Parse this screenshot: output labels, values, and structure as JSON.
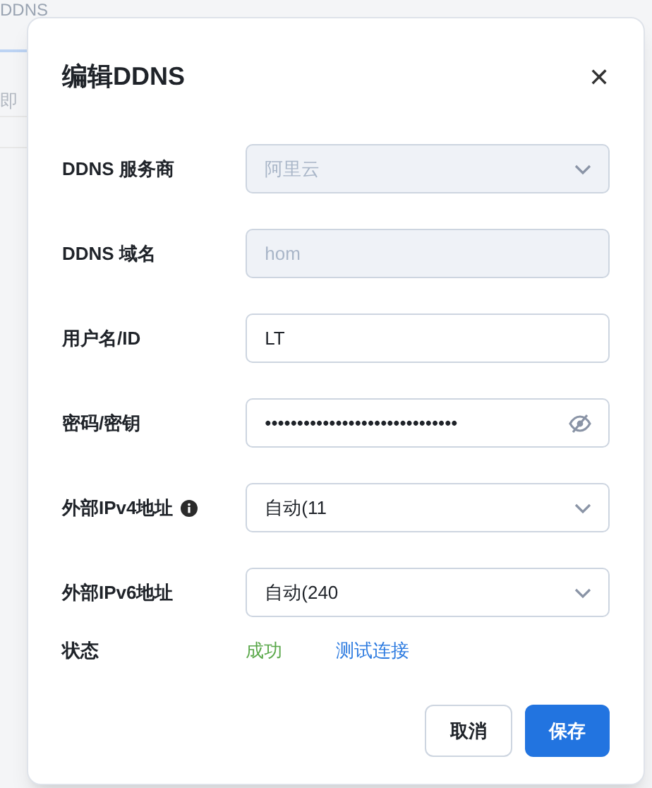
{
  "background_page": {
    "tab": {
      "label": "DDNS",
      "selected": true
    },
    "text": "即"
  },
  "dialog": {
    "title": "编辑DDNS",
    "close": "✕",
    "fields": [
      {
        "label": "DDNS 服务商",
        "kind": "select",
        "value": "阿里云",
        "disabled": true
      },
      {
        "label": "DDNS 域名",
        "kind": "text",
        "value": "hom",
        "disabled": true
      },
      {
        "label": "用户名/ID",
        "kind": "text",
        "value": "LT",
        "disabled": false
      },
      {
        "label": "密码/密钥",
        "kind": "password",
        "value": "••••••••••••••••••••••••••••••",
        "disabled": false
      },
      {
        "label": "外部IPv4地址",
        "kind": "select",
        "value": "自动(11",
        "disabled": false,
        "info": true
      },
      {
        "label": "外部IPv6地址",
        "kind": "select",
        "value": "自动(240",
        "disabled": false
      }
    ],
    "status": {
      "label": "状态",
      "value": "成功",
      "link": "测试连接"
    },
    "buttons": [
      {
        "label": "取消",
        "kind": "secondary"
      },
      {
        "label": "保存",
        "kind": "primary"
      }
    ]
  }
}
